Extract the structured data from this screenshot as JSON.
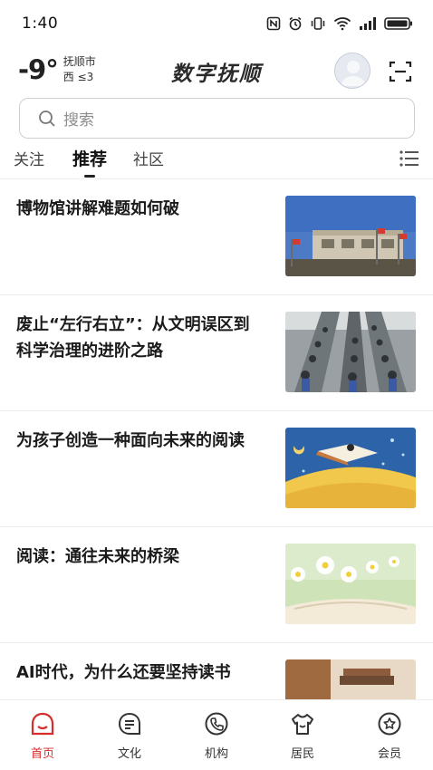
{
  "status_bar": {
    "time": "1:40",
    "battery_icon": "battery-icon",
    "signal_icon": "signal-icon",
    "wifi_icon": "wifi-icon"
  },
  "header": {
    "temperature": "-9°",
    "city": "抚顺市",
    "wind": "西  ≤3",
    "brand": "数字抚顺",
    "avatar_icon": "user-avatar-icon",
    "scan_icon": "scan-icon"
  },
  "search": {
    "placeholder": "搜索",
    "icon": "search-icon"
  },
  "tabs": [
    {
      "label": "关注",
      "active": false
    },
    {
      "label": "推荐",
      "active": true
    },
    {
      "label": "社区",
      "active": false
    }
  ],
  "articles": [
    {
      "title": "博物馆讲解难题如何破",
      "thumb": "museum-building"
    },
    {
      "title": "废止“左行右立”：从文明误区到科学治理的进阶之路",
      "thumb": "escalator-crowd"
    },
    {
      "title": "为孩子创造一种面向未来的阅读",
      "thumb": "child-reading-illustration"
    },
    {
      "title": "阅读：通往未来的桥梁",
      "thumb": "flowers-on-book"
    },
    {
      "title": "AI时代，为什么还要坚持读书",
      "thumb": "books-on-desk"
    }
  ],
  "bottom_nav": [
    {
      "label": "首页",
      "icon": "home-icon",
      "active": true
    },
    {
      "label": "文化",
      "icon": "culture-icon",
      "active": false
    },
    {
      "label": "机构",
      "icon": "phone-icon",
      "active": false
    },
    {
      "label": "居民",
      "icon": "shirt-icon",
      "active": false
    },
    {
      "label": "会员",
      "icon": "star-badge-icon",
      "active": false
    }
  ],
  "colors": {
    "accent": "#d62c2c",
    "text_primary": "#1b1b1b",
    "border": "#cfcfcf"
  }
}
